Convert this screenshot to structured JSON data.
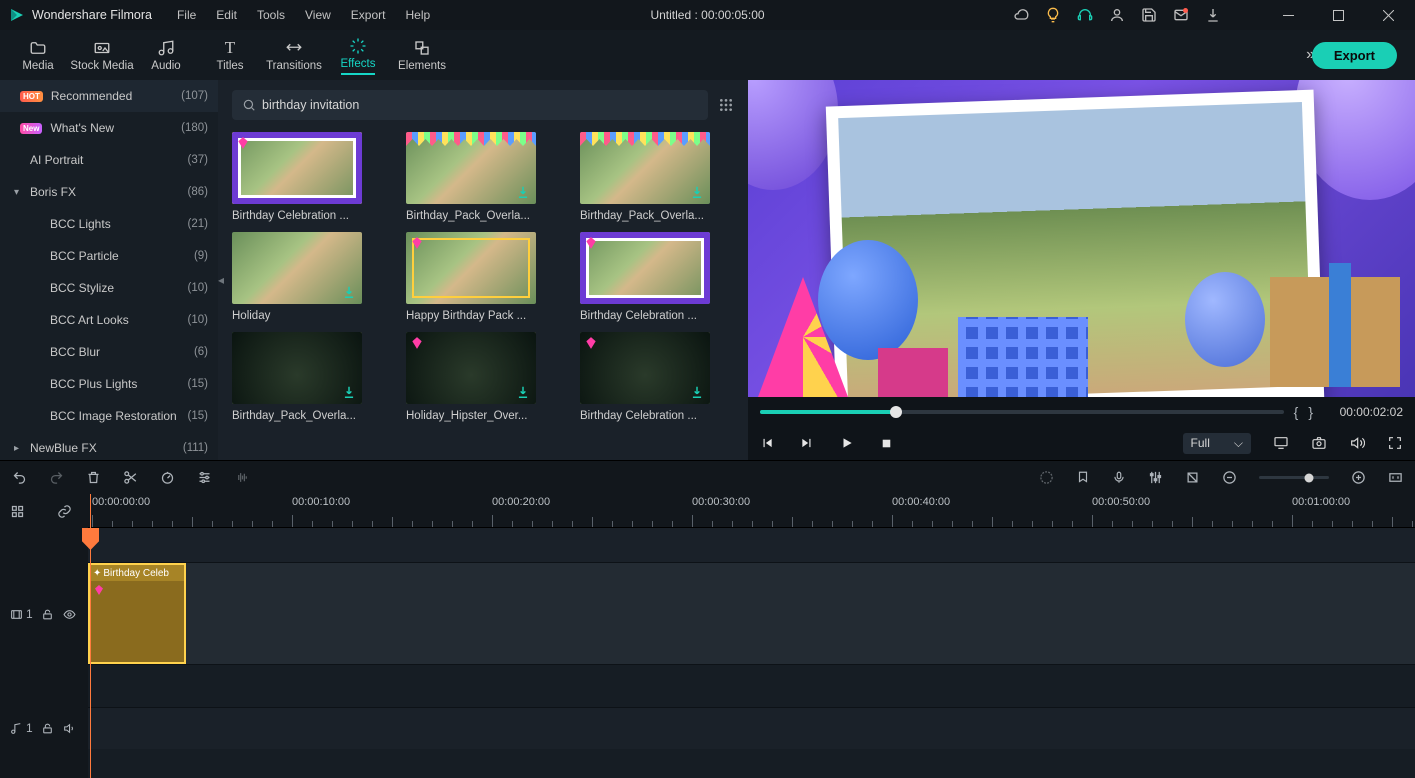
{
  "app_name": "Wondershare Filmora",
  "menu": [
    "File",
    "Edit",
    "Tools",
    "View",
    "Export",
    "Help"
  ],
  "document_title": "Untitled : 00:00:05:00",
  "title_icons": [
    "cloud",
    "hint",
    "headset",
    "user",
    "save",
    "mail",
    "download"
  ],
  "window_buttons": [
    "minimize",
    "maximize",
    "close"
  ],
  "main_tabs": [
    {
      "id": "media",
      "label": "Media",
      "icon": "folder"
    },
    {
      "id": "stock",
      "label": "Stock Media",
      "icon": "frame"
    },
    {
      "id": "audio",
      "label": "Audio",
      "icon": "music"
    },
    {
      "id": "titles",
      "label": "Titles",
      "icon": "T"
    },
    {
      "id": "transitions",
      "label": "Transitions",
      "icon": "swap"
    },
    {
      "id": "effects",
      "label": "Effects",
      "icon": "spark",
      "active": true
    },
    {
      "id": "elements",
      "label": "Elements",
      "icon": "stack"
    }
  ],
  "export_label": "Export",
  "categories": [
    {
      "name": "Recommended",
      "count": "(107)",
      "badge": "HOT",
      "selected": true
    },
    {
      "name": "What's New",
      "count": "(180)",
      "badge": "New"
    },
    {
      "name": "AI Portrait",
      "count": "(37)"
    },
    {
      "name": "Boris FX",
      "count": "(86)",
      "expandable": true,
      "expanded": true
    },
    {
      "name": "BCC Lights",
      "count": "(21)",
      "sub": true
    },
    {
      "name": "BCC Particle",
      "count": "(9)",
      "sub": true
    },
    {
      "name": "BCC Stylize",
      "count": "(10)",
      "sub": true
    },
    {
      "name": "BCC Art Looks",
      "count": "(10)",
      "sub": true
    },
    {
      "name": "BCC Blur",
      "count": "(6)",
      "sub": true
    },
    {
      "name": "BCC Plus Lights",
      "count": "(15)",
      "sub": true
    },
    {
      "name": "BCC Image Restoration",
      "count": "(15)",
      "sub": true
    },
    {
      "name": "NewBlue FX",
      "count": "(111)",
      "expandable": true
    }
  ],
  "search": {
    "placeholder": "",
    "value": "birthday invitation"
  },
  "effects": [
    {
      "label": "Birthday Celebration ...",
      "style": "balloons",
      "gem": true,
      "selected": true
    },
    {
      "label": "Birthday_Pack_Overla...",
      "style": "bunting",
      "dl": true
    },
    {
      "label": "Birthday_Pack_Overla...",
      "style": "bunting",
      "dl": true
    },
    {
      "label": "Holiday",
      "style": "plain",
      "dl": true
    },
    {
      "label": "Happy Birthday Pack ...",
      "style": "yellow",
      "gem": true
    },
    {
      "label": "Birthday Celebration ...",
      "style": "balloons",
      "gem": true
    },
    {
      "label": "Birthday_Pack_Overla...",
      "style": "dark",
      "dl": true
    },
    {
      "label": "Holiday_Hipster_Over...",
      "style": "dark",
      "gem": true,
      "dl": true
    },
    {
      "label": "Birthday Celebration ...",
      "style": "dark",
      "gem": true,
      "dl": true
    }
  ],
  "preview": {
    "timecode": "00:00:02:02",
    "quality": "Full"
  },
  "timeline": {
    "ruler_labels": [
      "00:00:00:00",
      "00:00:10:00",
      "00:00:20:00",
      "00:00:30:00",
      "00:00:40:00",
      "00:00:50:00",
      "00:01:00:00"
    ],
    "clip": {
      "label": "Birthday Celeb"
    },
    "video_track": "1",
    "audio_track": "1"
  }
}
